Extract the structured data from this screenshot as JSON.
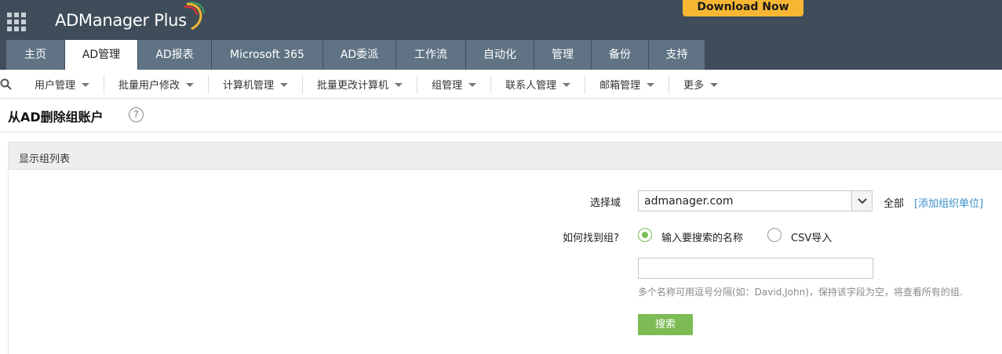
{
  "header": {
    "logo_text": "ADManager Plus",
    "download_label": "Download Now",
    "tabs": [
      {
        "label": "主页"
      },
      {
        "label": "AD管理"
      },
      {
        "label": "AD报表"
      },
      {
        "label": "Microsoft 365"
      },
      {
        "label": "AD委派"
      },
      {
        "label": "工作流"
      },
      {
        "label": "自动化"
      },
      {
        "label": "管理"
      },
      {
        "label": "备份"
      },
      {
        "label": "支持"
      }
    ],
    "active_tab": "AD管理"
  },
  "subnav": {
    "items": [
      {
        "label": "用户管理"
      },
      {
        "label": "批量用户修改"
      },
      {
        "label": "计算机管理"
      },
      {
        "label": "批量更改计算机"
      },
      {
        "label": "组管理"
      },
      {
        "label": "联系人管理"
      },
      {
        "label": "邮箱管理"
      },
      {
        "label": "更多"
      }
    ]
  },
  "page": {
    "title": "从AD删除组账户",
    "help_glyph": "?"
  },
  "panel": {
    "heading": "显示组列表",
    "domain_label": "选择域",
    "domain_value": "admanager.com",
    "all_label": "全部",
    "add_ou_label": "[添加组织单位]",
    "find_label": "如何找到组?",
    "option_search": "输入要搜索的名称",
    "option_csv": "CSV导入",
    "selected_option": "search",
    "input_value": "",
    "hint": "多个名称可用逗号分隔(如：David,John)，保持该字段为空，将查看所有的组.",
    "search_button": "搜索"
  },
  "colors": {
    "header_bg": "#3f4d5a",
    "tab_bg": "#5f7384",
    "download_bg": "#f7b733",
    "accent_green": "#7dbb55",
    "link_blue": "#3a8fc7"
  }
}
